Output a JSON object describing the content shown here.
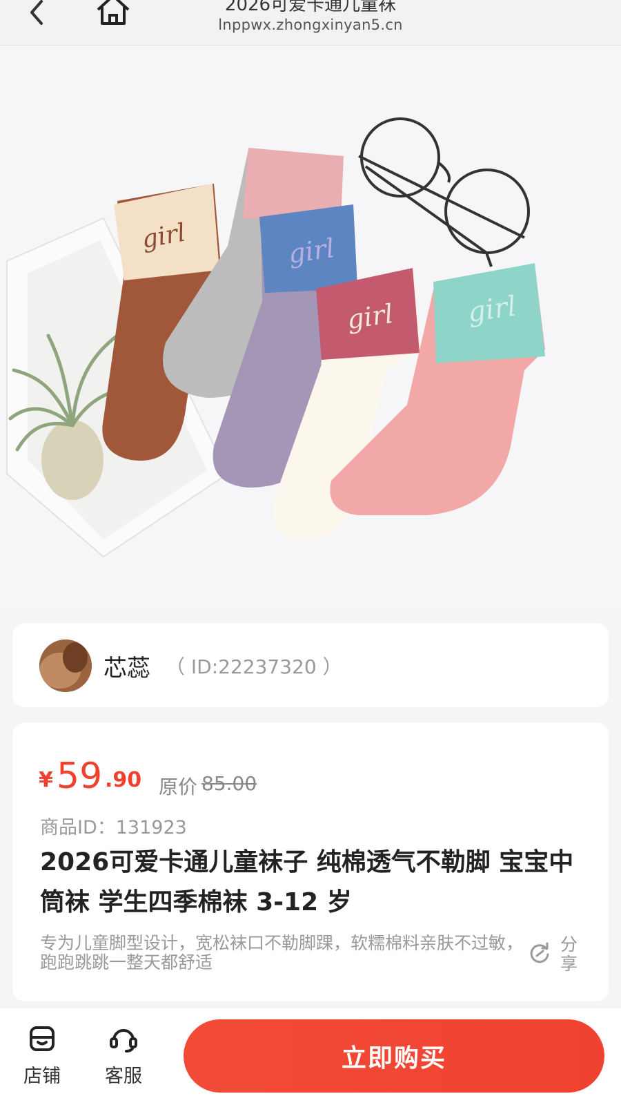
{
  "header": {
    "title": "2026可爱卡通儿童袜",
    "url": "lnppwx.zhongxinyan5.cn"
  },
  "shop": {
    "name": "芯蕊",
    "id_text": "（ ID:22237320 ）"
  },
  "product": {
    "currency": "¥",
    "price_int": "59",
    "price_dec": ".90",
    "original_label": "原价",
    "original_price": "85.00",
    "goods_id": "商品ID：131923",
    "title": "2026可爱卡通儿童袜子 纯棉透气不勒脚 宝宝中筒袜 学生四季棉袜 3-12 岁",
    "description": "专为儿童脚型设计，宽松袜口不勒脚踝，软糯棉料亲肤不过敏，跑跑跳跳一整天都舒适",
    "share_label": "分享"
  },
  "sock_labels": [
    "girl",
    "girl",
    "girl",
    "girl"
  ],
  "bottom_bar": {
    "store_label": "店铺",
    "service_label": "客服",
    "buy_label": "立即购买"
  },
  "colors": {
    "accent": "#f0412f",
    "buy_button": "#f14b37"
  }
}
